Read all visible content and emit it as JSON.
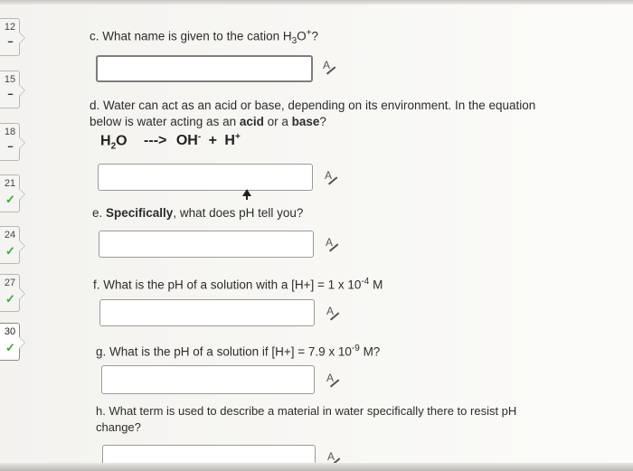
{
  "sidebar": {
    "tabs": [
      {
        "num": "12",
        "status": "--"
      },
      {
        "num": "15",
        "status": "--"
      },
      {
        "num": "18",
        "status": "--"
      },
      {
        "num": "21",
        "status": "✓"
      },
      {
        "num": "24",
        "status": "✓"
      },
      {
        "num": "27",
        "status": "✓"
      },
      {
        "num": "30",
        "status": "✓"
      }
    ]
  },
  "questions": {
    "c": {
      "prefix": "c. What name is given to the cation H",
      "sub": "3",
      "mid": "O",
      "sup": "+",
      "suffix": "?"
    },
    "d": {
      "line1": "d. Water can act as an acid or base, depending on its environment.  In the equation",
      "line2_prefix": "below is water acting as an ",
      "acid": "acid",
      "or": " or a ",
      "base": "base",
      "q": "?",
      "eq_h": "H",
      "eq_2": "2",
      "eq_o": "O",
      "eq_arrow": "--->",
      "eq_oh": "OH",
      "eq_minus": "-",
      "eq_plus_sign": "+",
      "eq_h2": "H",
      "eq_hplus": "+"
    },
    "e": {
      "prefix": "e. ",
      "bold": "Specifically",
      "suffix": ", what does pH tell you?"
    },
    "f": {
      "prefix": "f.  What is the pH of a solution with a [H+] = 1 x 10",
      "sup": "-4",
      "suffix": " M"
    },
    "g": {
      "prefix": "g.  What is the pH of a solution if [H+] = 7.9 x 10",
      "sup": "-9",
      "suffix": " M?"
    },
    "h": {
      "line1": "h.  What term is used to describe a material in water specifically there to resist pH",
      "line2": "change?"
    }
  },
  "answers": {
    "c": "",
    "d": "",
    "e": "",
    "f": "",
    "g": "",
    "h": ""
  },
  "icons": {
    "spellcheck": "spellcheck-icon",
    "cursor": "mouse-cursor-icon"
  }
}
